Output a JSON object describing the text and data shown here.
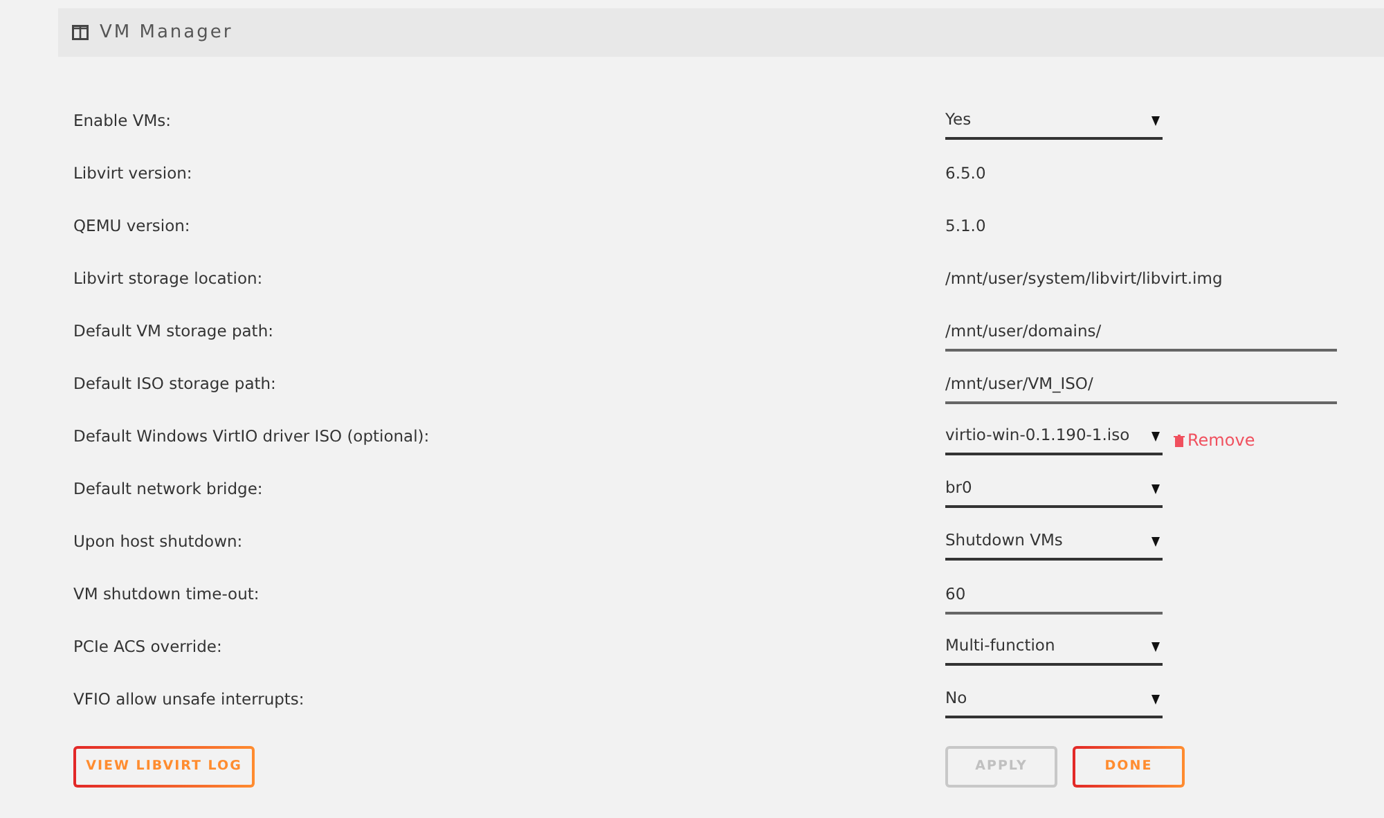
{
  "header": {
    "title": "VM Manager"
  },
  "settings": [
    {
      "label": "Enable VMs:",
      "kind": "select",
      "value": "Yes"
    },
    {
      "label": "Libvirt version:",
      "kind": "text",
      "value": "6.5.0"
    },
    {
      "label": "QEMU version:",
      "kind": "text",
      "value": "5.1.0"
    },
    {
      "label": "Libvirt storage location:",
      "kind": "text",
      "value": "/mnt/user/system/libvirt/libvirt.img"
    },
    {
      "label": "Default VM storage path:",
      "kind": "wide_input",
      "value": "/mnt/user/domains/"
    },
    {
      "label": "Default ISO storage path:",
      "kind": "wide_input",
      "value": "/mnt/user/VM_ISO/"
    },
    {
      "label": "Default Windows VirtIO driver ISO (optional):",
      "kind": "select",
      "value": "virtio-win-0.1.190-1.iso",
      "action": "Remove"
    },
    {
      "label": "Default network bridge:",
      "kind": "select",
      "value": "br0"
    },
    {
      "label": "Upon host shutdown:",
      "kind": "select",
      "value": "Shutdown VMs"
    },
    {
      "label": "VM shutdown time-out:",
      "kind": "input",
      "value": "60"
    },
    {
      "label": "PCIe ACS override:",
      "kind": "select",
      "value": "Multi-function"
    },
    {
      "label": "VFIO allow unsafe interrupts:",
      "kind": "select",
      "value": "No"
    }
  ],
  "buttons": {
    "log": {
      "label": "VIEW LIBVIRT LOG",
      "disabled": false
    },
    "apply": {
      "label": "APPLY",
      "disabled": true
    },
    "done": {
      "label": "DONE",
      "disabled": false
    }
  }
}
